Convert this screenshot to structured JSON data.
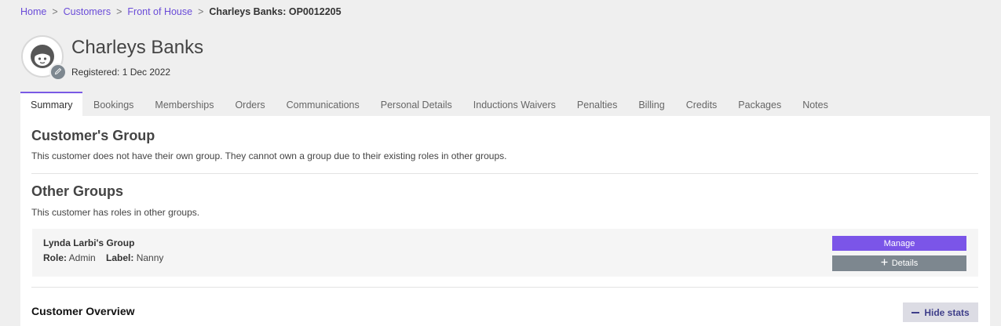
{
  "breadcrumb": {
    "items": [
      "Home",
      "Customers",
      "Front of House"
    ],
    "separator": ">",
    "current": "Charleys Banks: OP0012205"
  },
  "profile": {
    "name": "Charleys Banks",
    "registered": "Registered: 1 Dec 2022"
  },
  "tabs": [
    "Summary",
    "Bookings",
    "Memberships",
    "Orders",
    "Communications",
    "Personal Details",
    "Inductions Waivers",
    "Penalties",
    "Billing",
    "Credits",
    "Packages",
    "Notes"
  ],
  "active_tab": "Summary",
  "customers_group": {
    "title": "Customer's Group",
    "text": "This customer does not have their own group. They cannot own a group due to their existing roles in other groups."
  },
  "other_groups": {
    "title": "Other Groups",
    "text": "This customer has roles in other groups.",
    "group": {
      "name": "Lynda Larbi's Group",
      "role_label": "Role:",
      "role": "Admin",
      "label_label": "Label:",
      "label": "Nanny",
      "manage_label": "Manage",
      "details_label": "Details"
    }
  },
  "overview": {
    "title": "Customer Overview",
    "hide_stats_label": "Hide stats"
  },
  "colors": {
    "accent": "#7b55e8",
    "link": "#6a4bd8",
    "secondary_button": "#7d878f"
  },
  "icons": {
    "avatar": "face-icon",
    "edit": "pencil-icon",
    "details": "plus-icon",
    "hide": "minus-icon"
  }
}
